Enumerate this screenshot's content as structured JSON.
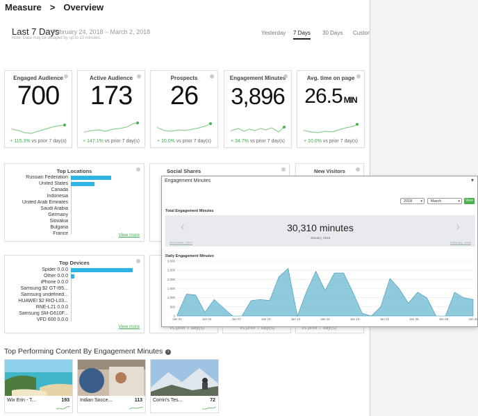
{
  "breadcrumb": {
    "root": "Measure",
    "sep": ">",
    "page": "Overview"
  },
  "period": {
    "title": "Last 7 Days",
    "dates": "February 24, 2018  –  March 2, 2018",
    "note": "Note: Data may be delayed by up to 10 minutes."
  },
  "ranges": [
    "Yesterday",
    "7 Days",
    "30 Days",
    "Custom"
  ],
  "metrics": [
    {
      "title": "Engaged Audience",
      "value": "700",
      "change": "+ 115.3%",
      "suffix": " vs prior 7 day(s)"
    },
    {
      "title": "Active Audience",
      "value": "173",
      "change": "+ 147.1%",
      "suffix": " vs prior 7 day(s)"
    },
    {
      "title": "Prospects",
      "value": "26",
      "change": "+ 10.0%",
      "suffix": " vs prior 7 day(s)"
    },
    {
      "title": "Engagement Minutes",
      "value": "3,896",
      "change": "+ 34.7%",
      "suffix": " vs prior 7 day(s)"
    },
    {
      "title": "Avg. time on page",
      "value": "26.5",
      "unit": "MIN",
      "change": "+ 10.0%",
      "suffix": " vs prior 7 day(s)"
    }
  ],
  "locations": {
    "title": "Top Locations",
    "view_more": "View more",
    "items": [
      {
        "label": "Russian Federation",
        "value": 1.0
      },
      {
        "label": "United States",
        "value": 0.58
      },
      {
        "label": "Canada",
        "value": 0.02
      },
      {
        "label": "Indonesia",
        "value": 0.02
      },
      {
        "label": "United Arab Emirates",
        "value": 0.02
      },
      {
        "label": "Saudi Arabia",
        "value": 0.02
      },
      {
        "label": "Germany",
        "value": 0.02
      },
      {
        "label": "Slovakia",
        "value": 0.02
      },
      {
        "label": "Bulgaria",
        "value": 0.02
      },
      {
        "label": "France",
        "value": 0.02
      }
    ]
  },
  "social": {
    "title": "Social Shares"
  },
  "visitors": {
    "title": "New Visitors"
  },
  "devices": {
    "title": "Top Devices",
    "view_more": "View more",
    "items": [
      {
        "label": "Spider 0.0.0",
        "value": 1.0
      },
      {
        "label": "Other 0.0.0",
        "value": 0.05
      },
      {
        "label": "iPhone 0.0.0",
        "value": 0.02
      },
      {
        "label": "Samsung $2 GT-I95...",
        "value": 0.02
      },
      {
        "label": "Samsung undefined...",
        "value": 0.02
      },
      {
        "label": "HUAWEI $2 RIO-L03...",
        "value": 0.02
      },
      {
        "label": "RNE-L21 0.0.0",
        "value": 0.02
      },
      {
        "label": "Samsung SM-G610F...",
        "value": 0.02
      },
      {
        "label": "VFD 600 0.0.0",
        "value": 0.02
      }
    ]
  },
  "partial_text": {
    "prior": "vs prior 7 day(s)"
  },
  "content": {
    "title": "Top Performing Content By Engagement Minutes",
    "items": [
      {
        "caption": "Wix Erin - T...",
        "value": "193"
      },
      {
        "caption": "Indian Socce...",
        "value": "113"
      },
      {
        "caption": "Corrin's Tes...",
        "value": "72"
      }
    ]
  },
  "popup": {
    "header": "Engagement Minutes",
    "year": "2018",
    "month": "March",
    "view": "View",
    "total_label": "Total Engagement Minutes",
    "total": "30,310 minutes",
    "total_sub": "January, 2018",
    "prev": "December, 2017",
    "next": "February, 2018",
    "daily_label": "Daily Engagement Minutes"
  },
  "chart_data": {
    "type": "area",
    "title": "Daily Engagement Minutes",
    "ylim": [
      0,
      3000
    ],
    "yticks": [
      "0",
      "500",
      "1,000",
      "1,500",
      "2,000",
      "2,500",
      "3,000"
    ],
    "xticks": [
      "Jan 01",
      "Jan 04",
      "Jan 07",
      "Jan 10",
      "Jan 13",
      "Jan 16",
      "Jan 19",
      "Jan 22",
      "Jan 25",
      "Jan 28",
      "Jan 31"
    ],
    "x": [
      1,
      2,
      3,
      4,
      5,
      6,
      7,
      8,
      9,
      10,
      11,
      12,
      13,
      14,
      15,
      16,
      17,
      18,
      19,
      20,
      21,
      22,
      23,
      24,
      25,
      26,
      27,
      28,
      29,
      30,
      31
    ],
    "values": [
      50,
      1200,
      1150,
      200,
      900,
      450,
      0,
      0,
      850,
      900,
      850,
      2150,
      2600,
      0,
      1350,
      2450,
      1400,
      2350,
      2350,
      1300,
      150,
      0,
      500,
      2050,
      1500,
      700,
      1300,
      1000,
      0,
      0,
      1300,
      1000,
      900
    ],
    "grid": true,
    "color": "#5fb3cf"
  }
}
